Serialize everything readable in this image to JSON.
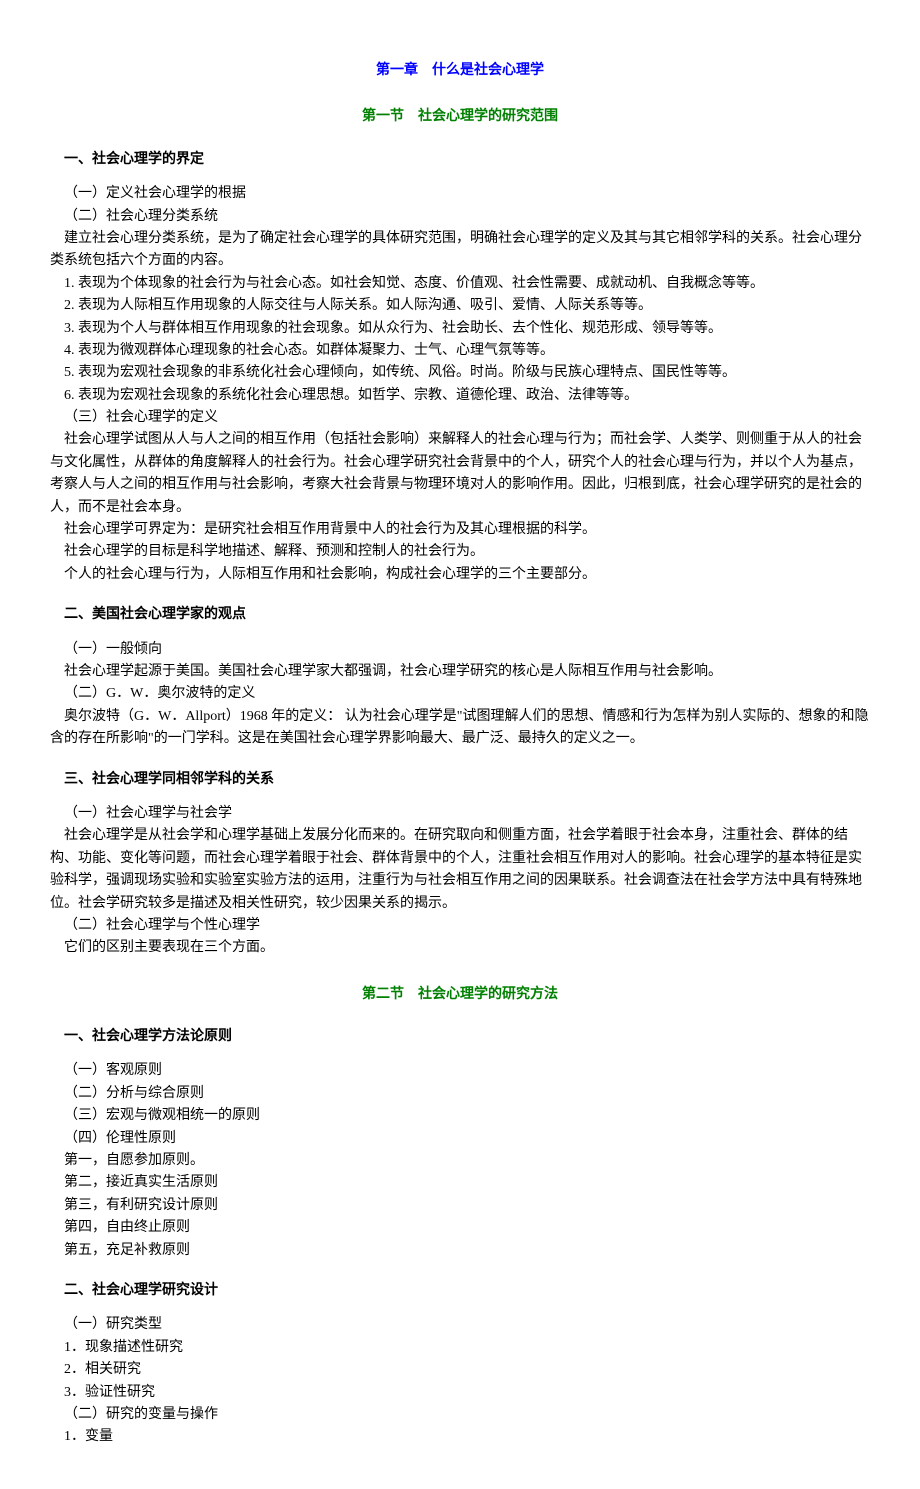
{
  "chapter": "第一章　什么是社会心理学",
  "section1": {
    "title": "第一节　社会心理学的研究范围",
    "h1": "一、社会心理学的界定",
    "p1_1": "（一）定义社会心理学的根据",
    "p1_2": "（二）社会心理分类系统",
    "p1_3": "建立社会心理分类系统，是为了确定社会心理学的具体研究范围，明确社会心理学的定义及其与其它相邻学科的关系。社会心理分类系统包括六个方面的内容。",
    "p1_4": "1. 表现为个体现象的社会行为与社会心态。如社会知觉、态度、价值观、社会性需要、成就动机、自我概念等等。",
    "p1_5": "2. 表现为人际相互作用现象的人际交往与人际关系。如人际沟通、吸引、爱情、人际关系等等。",
    "p1_6": "3. 表现为个人与群体相互作用现象的社会现象。如从众行为、社会助长、去个性化、规范形成、领导等等。",
    "p1_7": "4. 表现为微观群体心理现象的社会心态。如群体凝聚力、士气、心理气氛等等。",
    "p1_8": "5. 表现为宏观社会现象的非系统化社会心理倾向，如传统、风俗。时尚。阶级与民族心理特点、国民性等等。",
    "p1_9": "6. 表现为宏观社会现象的系统化社会心理思想。如哲学、宗教、道德伦理、政治、法律等等。",
    "p1_10": "（三）社会心理学的定义",
    "p1_11": "社会心理学试图从人与人之间的相互作用（包括社会影响）来解释人的社会心理与行为；而社会学、人类学、则侧重于从人的社会与文化属性，从群体的角度解释人的社会行为。社会心理学研究社会背景中的个人，研究个人的社会心理与行为，并以个人为基点，考察人与人之间的相互作用与社会影响，考察大社会背景与物理环境对人的影响作用。因此，归根到底，社会心理学研究的是社会的人，而不是社会本身。",
    "p1_12": "社会心理学可界定为：是研究社会相互作用背景中人的社会行为及其心理根据的科学。",
    "p1_13": "社会心理学的目标是科学地描述、解释、预测和控制人的社会行为。",
    "p1_14": "个人的社会心理与行为，人际相互作用和社会影响，构成社会心理学的三个主要部分。",
    "h2": "二、美国社会心理学家的观点",
    "p2_1": "（一）一般倾向",
    "p2_2": "社会心理学起源于美国。美国社会心理学家大都强调，社会心理学研究的核心是人际相互作用与社会影响。",
    "p2_3": "（二）G．W．奥尔波特的定义",
    "p2_4": "奥尔波特（G．W．Allport）1968 年的定义：  认为社会心理学是\"试图理解人们的思想、情感和行为怎样为别人实际的、想象的和隐含的存在所影响\"的一门学科。这是在美国社会心理学界影响最大、最广泛、最持久的定义之一。",
    "h3": "三、社会心理学同相邻学科的关系",
    "p3_1": "（一）社会心理学与社会学",
    "p3_2": "社会心理学是从社会学和心理学基础上发展分化而来的。在研究取向和侧重方面，社会学着眼于社会本身，注重社会、群体的结构、功能、变化等问题，而社会心理学着眼于社会、群体背景中的个人，注重社会相互作用对人的影响。社会心理学的基本特征是实验科学，强调现场实验和实验室实验方法的运用，注重行为与社会相互作用之间的因果联系。社会调查法在社会学方法中具有特殊地位。社会学研究较多是描述及相关性研究，较少因果关系的揭示。",
    "p3_3": "（二）社会心理学与个性心理学",
    "p3_4": "它们的区别主要表现在三个方面。"
  },
  "section2": {
    "title": "第二节　社会心理学的研究方法",
    "h1": "一、社会心理学方法论原则",
    "p1_1": "（一）客观原则",
    "p1_2": "（二）分析与综合原则",
    "p1_3": "（三）宏观与微观相统一的原则",
    "p1_4": "（四）伦理性原则",
    "p1_5": "第一，自愿参加原则。",
    "p1_6": "第二，接近真实生活原则",
    "p1_7": "第三，有利研究设计原则",
    "p1_8": "第四，自由终止原则",
    "p1_9": "第五，充足补救原则",
    "h2": "二、社会心理学研究设计",
    "p2_1": "（一）研究类型",
    "p2_2": "1．现象描述性研究",
    "p2_3": "2．相关研究",
    "p2_4": "3．验证性研究",
    "p2_5": "（二）研究的变量与操作",
    "p2_6": "1．变量"
  }
}
